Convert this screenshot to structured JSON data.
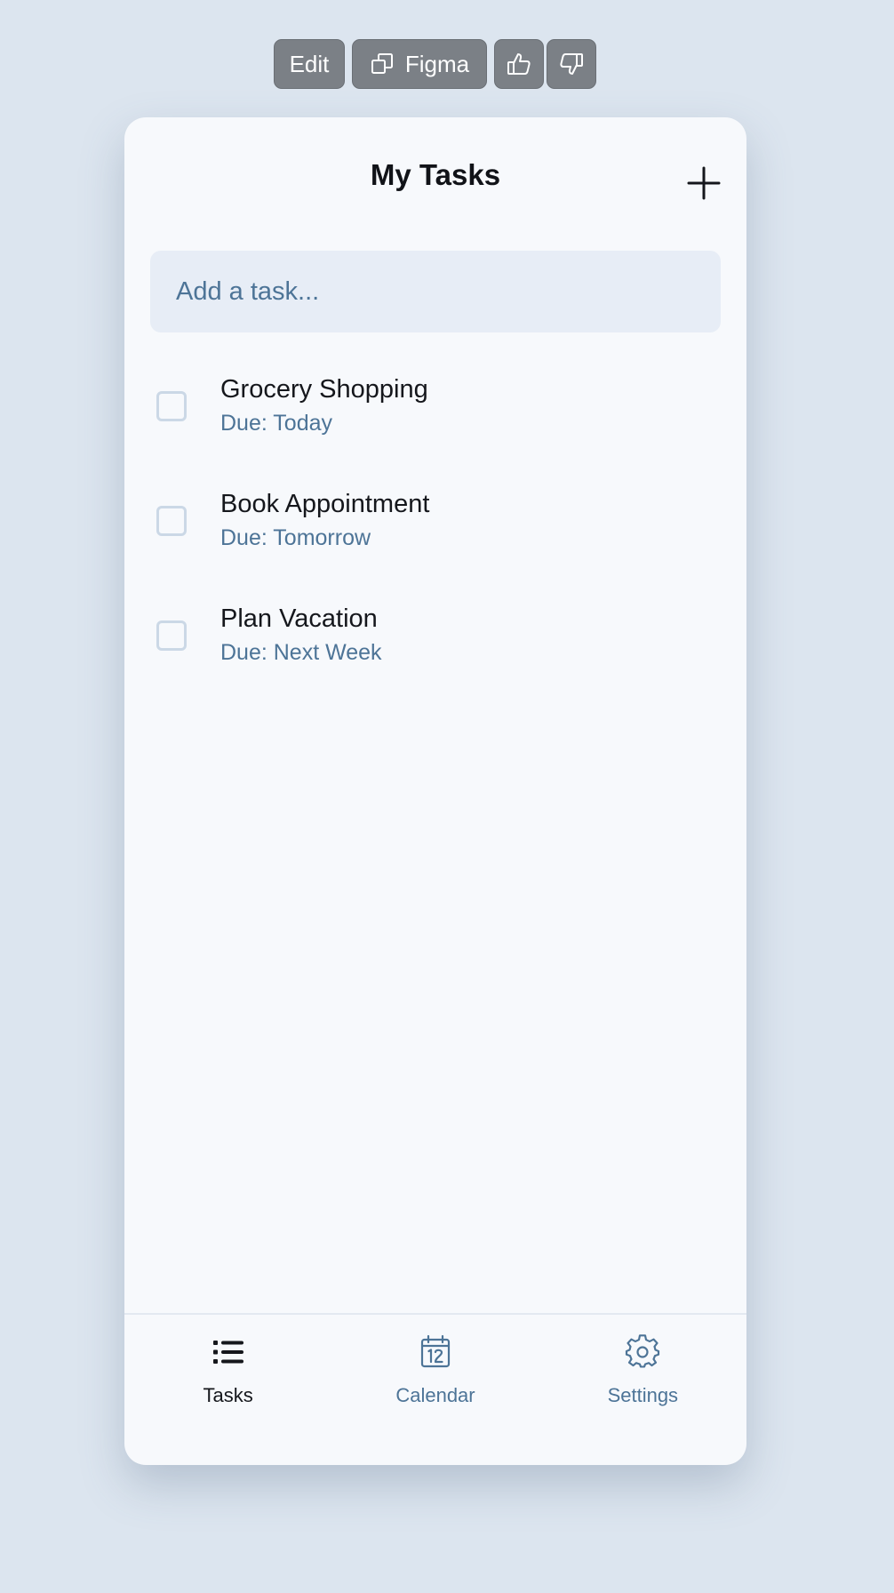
{
  "toolbar": {
    "edit_label": "Edit",
    "figma_label": "Figma"
  },
  "app": {
    "title": "My Tasks",
    "input_placeholder": "Add a task...",
    "tasks": [
      {
        "name": "Grocery Shopping",
        "due": "Due: Today",
        "checked": false
      },
      {
        "name": "Book Appointment",
        "due": "Due: Tomorrow",
        "checked": false
      },
      {
        "name": "Plan Vacation",
        "due": "Due: Next Week",
        "checked": false
      }
    ]
  },
  "nav": {
    "items": [
      {
        "label": "Tasks",
        "icon": "list-icon",
        "active": true
      },
      {
        "label": "Calendar",
        "icon": "calendar-icon",
        "active": false
      },
      {
        "label": "Settings",
        "icon": "gear-icon",
        "active": false
      }
    ]
  },
  "colors": {
    "page_bg": "#dce5ef",
    "card_bg": "#f7f9fc",
    "accent_text": "#4d7497",
    "primary_text": "#15171c",
    "toolbar_button": "#7b8086"
  }
}
